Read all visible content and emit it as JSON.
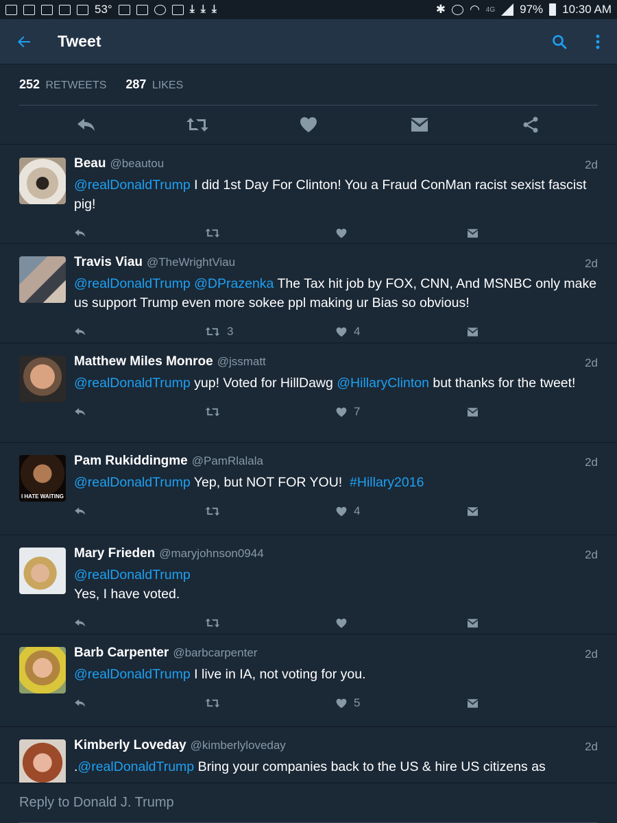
{
  "status_bar": {
    "temperature": "53°",
    "battery": "97%",
    "time": "10:30 AM",
    "network": "4G"
  },
  "app_bar": {
    "title": "Tweet",
    "back_icon": "arrow-left-icon",
    "search_icon": "search-icon",
    "menu_icon": "more-vertical-icon"
  },
  "stats": {
    "retweets_count": "252",
    "retweets_label": "RETWEETS",
    "likes_count": "287",
    "likes_label": "LIKES"
  },
  "actions": [
    "reply-icon",
    "retweet-icon",
    "like-icon",
    "message-icon",
    "share-icon"
  ],
  "accent_color": "#1da1f2",
  "replies": [
    {
      "name": "Beau",
      "handle": "@beautou",
      "time": "2d",
      "mention": "@realDonaldTrump",
      "text": " I did 1st Day For Clinton! You a Fraud ConMan racist sexist fascist pig!",
      "retweets": "",
      "likes": ""
    },
    {
      "name": "Travis Viau",
      "handle": "@TheWrightViau",
      "time": "2d",
      "mention": "@realDonaldTrump @DPrazenka",
      "text": " The Tax hit job by FOX, CNN, And MSNBC only make us support Trump even more sokee ppl making ur Bias so obvious!",
      "retweets": "3",
      "likes": "4"
    },
    {
      "name": "Matthew Miles Monroe",
      "handle": "@jssmatt",
      "time": "2d",
      "mention": "@realDonaldTrump",
      "text_a": " yup! Voted for HillDawg ",
      "mention_b": "@HillaryClinton",
      "text_b": " but thanks for the tweet!",
      "retweets": "",
      "likes": "7"
    },
    {
      "name": "Pam Rukiddingme",
      "handle": "@PamRlalala",
      "time": "2d",
      "mention": "@realDonaldTrump",
      "text": " Yep, but NOT FOR YOU!  ",
      "hashtag": "#Hillary2016",
      "avatar_caption": "I HATE WAITING",
      "retweets": "",
      "likes": "4"
    },
    {
      "name": "Mary Frieden",
      "handle": "@maryjohnson0944",
      "time": "2d",
      "mention": "@realDonaldTrump",
      "text": "Yes, I have voted.",
      "retweets": "",
      "likes": ""
    },
    {
      "name": "Barb Carpenter",
      "handle": "@barbcarpenter",
      "time": "2d",
      "mention": "@realDonaldTrump",
      "text": " I live in IA, not voting for you.",
      "retweets": "",
      "likes": "5"
    },
    {
      "name": "Kimberly Loveday",
      "handle": "@kimberlyloveday",
      "time": "2d",
      "prefix": ".",
      "mention": "@realDonaldTrump",
      "text": " Bring your companies back to the US & hire US citizens as",
      "retweets": "",
      "likes": ""
    }
  ],
  "composer": {
    "placeholder": "Reply to Donald J. Trump"
  }
}
